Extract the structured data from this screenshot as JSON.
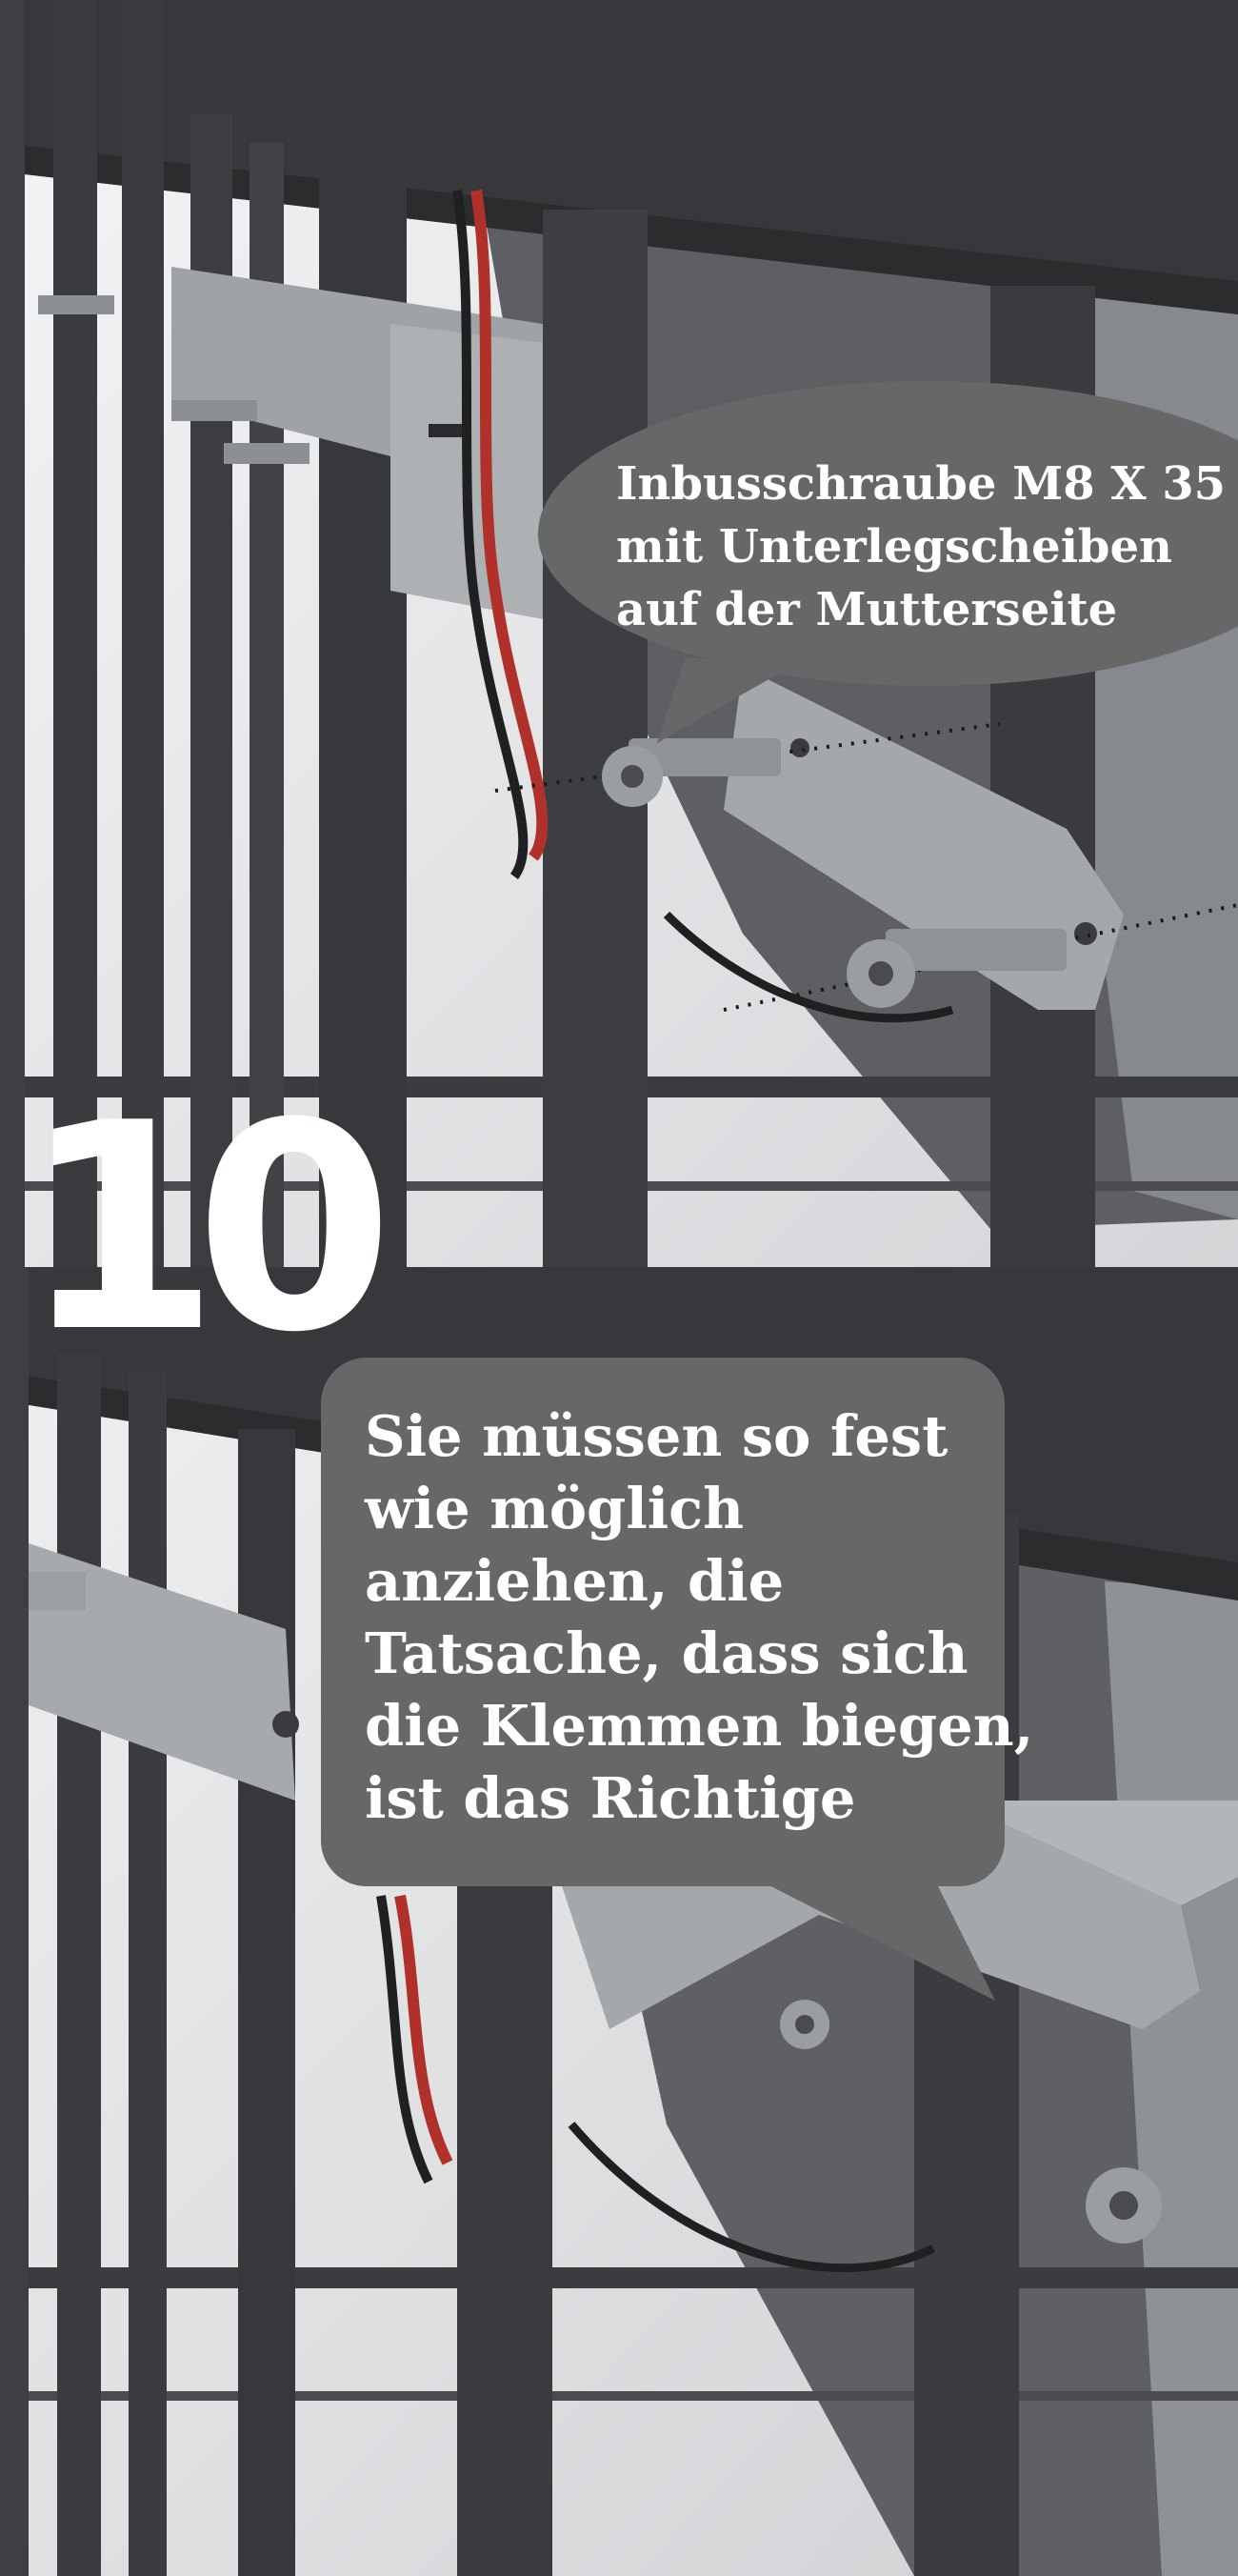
{
  "step": {
    "number": "10"
  },
  "bubbles": {
    "top": {
      "lines": [
        "Inbusschraube M8 X 35",
        "mit Unterlegscheiben",
        "auf der Mutterseite"
      ]
    },
    "bottom": {
      "lines": [
        "Sie müssen so fest",
        "wie möglich",
        "anziehen, die",
        "Tatsache, dass sich",
        "die Klemmen biegen,",
        "ist das Richtige"
      ]
    }
  },
  "colors": {
    "frame_metal": "#3b3c3f",
    "bracket_metal": "#a5a8ab",
    "bubble_fill": "#666767",
    "background": "#e9eaeb",
    "cable_red": "#b0302a"
  },
  "icons": {
    "bolt": "hex-socket-bolt-icon"
  }
}
